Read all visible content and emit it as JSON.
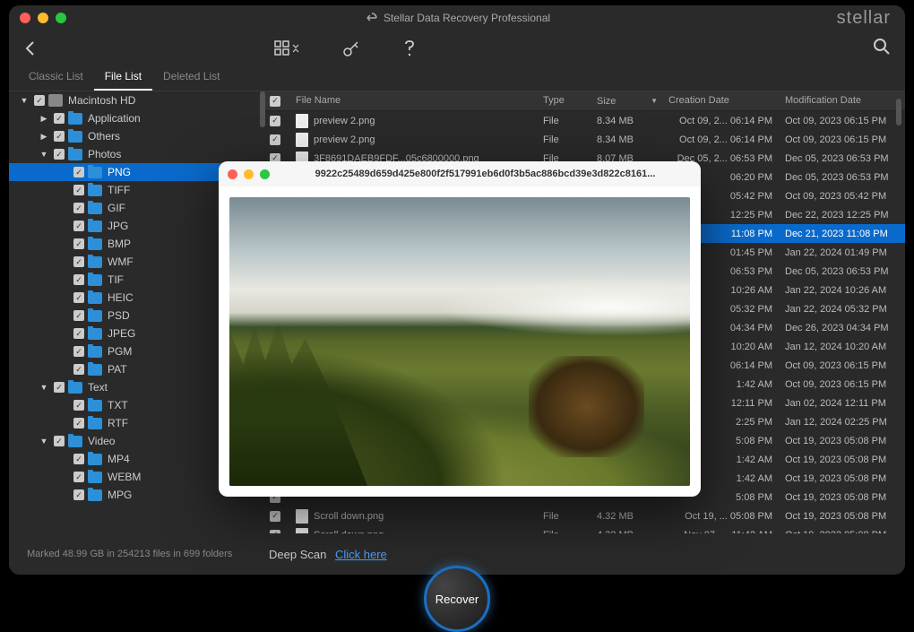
{
  "app_title": "Stellar Data Recovery Professional",
  "brand": "stellar",
  "tabs": {
    "classic": "Classic List",
    "file": "File List",
    "deleted": "Deleted List"
  },
  "columns": {
    "name": "File Name",
    "type": "Type",
    "size": "Size",
    "cdate": "Creation Date",
    "mdate": "Modification Date"
  },
  "tree": [
    {
      "depth": 0,
      "twist": "▼",
      "icon": "disk",
      "label": "Macintosh HD"
    },
    {
      "depth": 1,
      "twist": "▶",
      "icon": "folder",
      "label": "Application"
    },
    {
      "depth": 1,
      "twist": "▶",
      "icon": "folder",
      "label": "Others"
    },
    {
      "depth": 1,
      "twist": "▼",
      "icon": "folder",
      "label": "Photos"
    },
    {
      "depth": 2,
      "twist": "",
      "icon": "folder",
      "label": "PNG",
      "selected": true
    },
    {
      "depth": 2,
      "twist": "",
      "icon": "folder",
      "label": "TIFF"
    },
    {
      "depth": 2,
      "twist": "",
      "icon": "folder",
      "label": "GIF"
    },
    {
      "depth": 2,
      "twist": "",
      "icon": "folder",
      "label": "JPG"
    },
    {
      "depth": 2,
      "twist": "",
      "icon": "folder",
      "label": "BMP"
    },
    {
      "depth": 2,
      "twist": "",
      "icon": "folder",
      "label": "WMF"
    },
    {
      "depth": 2,
      "twist": "",
      "icon": "folder",
      "label": "TIF"
    },
    {
      "depth": 2,
      "twist": "",
      "icon": "folder",
      "label": "HEIC"
    },
    {
      "depth": 2,
      "twist": "",
      "icon": "folder",
      "label": "PSD"
    },
    {
      "depth": 2,
      "twist": "",
      "icon": "folder",
      "label": "JPEG"
    },
    {
      "depth": 2,
      "twist": "",
      "icon": "folder",
      "label": "PGM"
    },
    {
      "depth": 2,
      "twist": "",
      "icon": "folder",
      "label": "PAT"
    },
    {
      "depth": 1,
      "twist": "▼",
      "icon": "folder",
      "label": "Text"
    },
    {
      "depth": 2,
      "twist": "",
      "icon": "folder",
      "label": "TXT"
    },
    {
      "depth": 2,
      "twist": "",
      "icon": "folder",
      "label": "RTF"
    },
    {
      "depth": 1,
      "twist": "▼",
      "icon": "folder",
      "label": "Video"
    },
    {
      "depth": 2,
      "twist": "",
      "icon": "folder",
      "label": "MP4"
    },
    {
      "depth": 2,
      "twist": "",
      "icon": "folder",
      "label": "WEBM"
    },
    {
      "depth": 2,
      "twist": "",
      "icon": "folder",
      "label": "MPG"
    }
  ],
  "files": [
    {
      "name": "preview 2.png",
      "type": "File",
      "size": "8.34 MB",
      "cdate": "Oct 09, 2... 06:14 PM",
      "mdate": "Oct 09, 2023 06:15 PM"
    },
    {
      "name": "preview 2.png",
      "type": "File",
      "size": "8.34 MB",
      "cdate": "Oct 09, 2... 06:14 PM",
      "mdate": "Oct 09, 2023 06:15 PM"
    },
    {
      "name": "3F8691DAEB9FDF...05c6800000.png",
      "type": "File",
      "size": "8.07 MB",
      "cdate": "Dec 05, 2... 06:53 PM",
      "mdate": "Dec 05, 2023 06:53 PM"
    },
    {
      "name": "",
      "type": "",
      "size": "",
      "cdate": "06:20 PM",
      "mdate": "Dec 05, 2023 06:53 PM"
    },
    {
      "name": "",
      "type": "",
      "size": "",
      "cdate": "05:42 PM",
      "mdate": "Oct 09, 2023 05:42 PM"
    },
    {
      "name": "",
      "type": "",
      "size": "",
      "cdate": "12:25 PM",
      "mdate": "Dec 22, 2023 12:25 PM"
    },
    {
      "name": "",
      "type": "",
      "size": "",
      "cdate": "11:08 PM",
      "mdate": "Dec 21, 2023 11:08 PM",
      "selected": true
    },
    {
      "name": "",
      "type": "",
      "size": "",
      "cdate": "01:45 PM",
      "mdate": "Jan 22, 2024 01:49 PM"
    },
    {
      "name": "",
      "type": "",
      "size": "",
      "cdate": "06:53 PM",
      "mdate": "Dec 05, 2023 06:53 PM"
    },
    {
      "name": "",
      "type": "",
      "size": "",
      "cdate": "10:26 AM",
      "mdate": "Jan 22, 2024 10:26 AM"
    },
    {
      "name": "",
      "type": "",
      "size": "",
      "cdate": "05:32 PM",
      "mdate": "Jan 22, 2024 05:32 PM"
    },
    {
      "name": "",
      "type": "",
      "size": "",
      "cdate": "04:34 PM",
      "mdate": "Dec 26, 2023 04:34 PM"
    },
    {
      "name": "",
      "type": "",
      "size": "",
      "cdate": "10:20 AM",
      "mdate": "Jan 12, 2024 10:20 AM"
    },
    {
      "name": "",
      "type": "",
      "size": "",
      "cdate": "06:14 PM",
      "mdate": "Oct 09, 2023 06:15 PM"
    },
    {
      "name": "",
      "type": "",
      "size": "",
      "cdate": "1:42 AM",
      "mdate": "Oct 09, 2023 06:15 PM"
    },
    {
      "name": "",
      "type": "",
      "size": "",
      "cdate": "12:11 PM",
      "mdate": "Jan 02, 2024 12:11 PM"
    },
    {
      "name": "",
      "type": "",
      "size": "",
      "cdate": "2:25 PM",
      "mdate": "Jan 12, 2024 02:25 PM"
    },
    {
      "name": "",
      "type": "",
      "size": "",
      "cdate": "5:08 PM",
      "mdate": "Oct 19, 2023 05:08 PM"
    },
    {
      "name": "",
      "type": "",
      "size": "",
      "cdate": "1:42 AM",
      "mdate": "Oct 19, 2023 05:08 PM"
    },
    {
      "name": "",
      "type": "",
      "size": "",
      "cdate": "1:42 AM",
      "mdate": "Oct 19, 2023 05:08 PM"
    },
    {
      "name": "",
      "type": "",
      "size": "",
      "cdate": "5:08 PM",
      "mdate": "Oct 19, 2023 05:08 PM"
    },
    {
      "name": "Scroll down.png",
      "type": "File",
      "size": "4.32 MB",
      "cdate": "Oct 19, ... 05:08 PM",
      "mdate": "Oct 19, 2023 05:08 PM"
    },
    {
      "name": "Scroll down.png",
      "type": "File",
      "size": "4.32 MB",
      "cdate": "Nov 07, ... 11:42 AM",
      "mdate": "Oct 19, 2023 05:08 PM"
    }
  ],
  "preview_filename": "9922c25489d659d425e800f2f517991eb6d0f3b5ac886bcd39e3d822c8161...",
  "status": "Marked 48.99 GB in 254213 files in 699 folders",
  "deep_scan_label": "Deep Scan",
  "deep_scan_link": "Click here",
  "recover_label": "Recover"
}
